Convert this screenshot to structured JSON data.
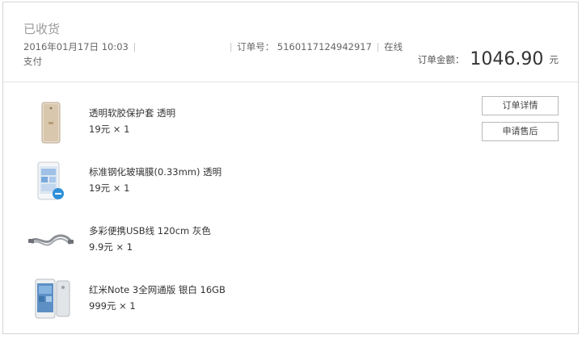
{
  "order": {
    "status": "已收货",
    "datetime": "2016年01月17日 10:03",
    "order_no_label": "订单号：",
    "order_no": "5160117124942917",
    "pay_method": "在线",
    "pay_method_2": "支付",
    "total_label": "订单金额：",
    "total_amount": "1046.90",
    "total_unit": "元"
  },
  "actions": {
    "detail_label": "订单详情",
    "aftersale_label": "申请售后"
  },
  "items": [
    {
      "name": "透明软胶保护套 透明",
      "price": "19元 × 1",
      "icon": "phone-case-icon"
    },
    {
      "name": "标准钢化玻璃膜(0.33mm) 透明",
      "price": "19元 × 1",
      "icon": "screen-protector-icon"
    },
    {
      "name": "多彩便携USB线 120cm 灰色",
      "price": "9.9元 × 1",
      "icon": "usb-cable-icon"
    },
    {
      "name": "红米Note 3全网通版 银白 16GB",
      "price": "999元 × 1",
      "icon": "phone-icon"
    }
  ]
}
